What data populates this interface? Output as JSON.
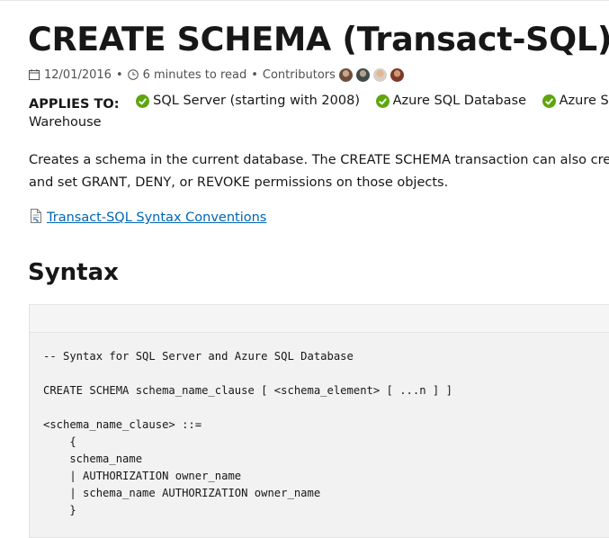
{
  "page": {
    "title": "CREATE SCHEMA (Transact-SQL)",
    "meta": {
      "date": "12/01/2016",
      "separator": "•",
      "read_time": "6 minutes to read",
      "contributors_label": "Contributors"
    },
    "applies_to": {
      "label": "APPLIES TO:",
      "products": [
        "SQL Server (starting with 2008)",
        "Azure SQL Database",
        "Azure SQL Data"
      ],
      "overflow_line": "Warehouse"
    },
    "description": {
      "line1": "Creates a schema in the current database. The CREATE SCHEMA transaction can also create",
      "line2": "and set GRANT, DENY, or REVOKE permissions on those objects."
    },
    "link_text": "Transact-SQL Syntax Conventions",
    "syntax_heading": "Syntax",
    "code_lines": [
      "-- Syntax for SQL Server and Azure SQL Database",
      "",
      "CREATE SCHEMA schema_name_clause [ <schema_element> [ ...n ] ]",
      "",
      "<schema_name_clause> ::=",
      "    {",
      "    schema_name",
      "    | AUTHORIZATION owner_name",
      "    | schema_name AUTHORIZATION owner_name",
      "    }"
    ]
  },
  "colors": {
    "link": "#0065b3",
    "check": "#5ea60d",
    "code_background": "#f2f2f2"
  },
  "icons": [
    "calendar-icon",
    "clock-icon",
    "check-circle-icon",
    "document-link-icon"
  ]
}
